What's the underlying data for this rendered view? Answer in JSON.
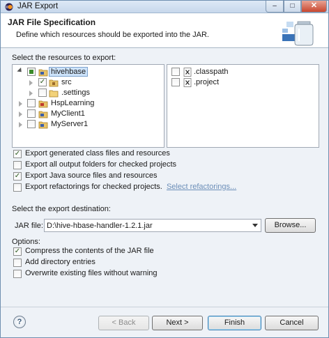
{
  "window": {
    "title": "JAR Export",
    "minimize": "–",
    "maximize": "□",
    "close": "✕"
  },
  "header": {
    "title": "JAR File Specification",
    "description": "Define which resources should be exported into the JAR."
  },
  "resources": {
    "label": "Select the resources to export:",
    "tree": [
      {
        "label": "hivehbase",
        "checked": "partial",
        "expanded": true,
        "selected": true,
        "icon": "project-icon"
      },
      {
        "label": "src",
        "checked": "checked",
        "icon": "package-folder-icon"
      },
      {
        "label": ".settings",
        "checked": "unchecked",
        "icon": "folder-icon"
      },
      {
        "label": "HspLearning",
        "checked": "unchecked",
        "icon": "project-icon"
      },
      {
        "label": "MyClient1",
        "checked": "unchecked",
        "icon": "project-icon"
      },
      {
        "label": "MyServer1",
        "checked": "unchecked",
        "icon": "project-icon"
      }
    ],
    "files": [
      {
        "label": ".classpath",
        "checked": "unchecked",
        "icon": "xml-file-icon"
      },
      {
        "label": ".project",
        "checked": "unchecked",
        "icon": "xml-file-icon"
      }
    ]
  },
  "options_top": [
    {
      "label": "Export generated class files and resources",
      "checked": true
    },
    {
      "label": "Export all output folders for checked projects",
      "checked": false
    },
    {
      "label": "Export Java source files and resources",
      "checked": true
    },
    {
      "label": "Export refactorings for checked projects.",
      "checked": false
    }
  ],
  "select_refactorings_link": "Select refactorings...",
  "destination": {
    "label": "Select the export destination:",
    "jar_label": "JAR file:",
    "jar_value": "D:\\hive-hbase-handler-1.2.1.jar",
    "browse": "Browse..."
  },
  "options": {
    "label": "Options:",
    "items": [
      {
        "label": "Compress the contents of the JAR file",
        "checked": true
      },
      {
        "label": "Add directory entries",
        "checked": false
      },
      {
        "label": "Overwrite existing files without warning",
        "checked": false
      }
    ]
  },
  "footer": {
    "help": "?",
    "back": "< Back",
    "next": "Next >",
    "finish": "Finish",
    "cancel": "Cancel"
  },
  "colors": {
    "accent": "#3c7fb1",
    "selection": "#cde3fa",
    "link": "#6b8eb8"
  }
}
